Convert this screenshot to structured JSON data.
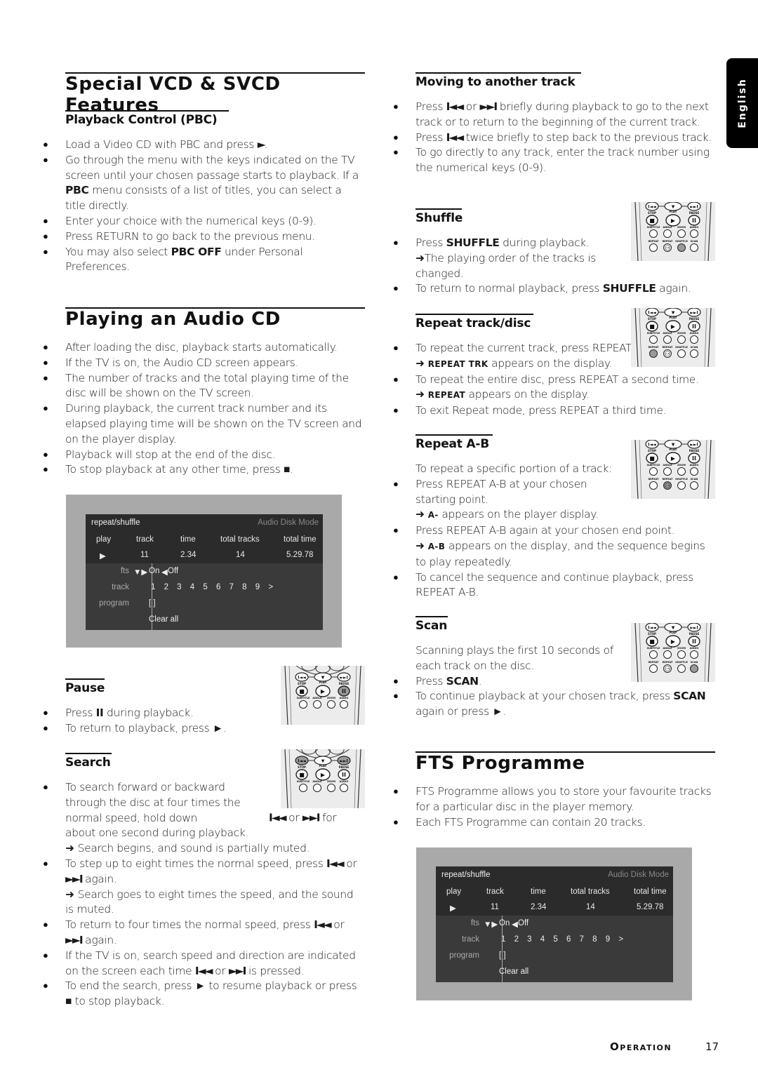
{
  "language_tab": "English",
  "footer": {
    "section": "Operation",
    "page_number": "17"
  },
  "vcd": {
    "title": "Special VCD & SVCD Features",
    "pbc": {
      "heading": "Playback Control (PBC)",
      "items": [
        {
          "pre": "Load a Video CD with PBC and press ",
          "glyph": "►",
          "post": "."
        },
        {
          "pre": "Go through the menu with the keys indicated on the TV screen until your chosen passage starts to playback. If a ",
          "bold": "PBC",
          "post": " menu consists of a list of titles, you can select a title directly."
        },
        {
          "text": "Enter your choice with the numerical keys (0-9)."
        },
        {
          "text": "Press RETURN to go back to the previous menu."
        },
        {
          "pre": "You may also select ",
          "bold": "PBC OFF",
          "post": " under Personal Preferences."
        }
      ]
    }
  },
  "audio": {
    "title": "Playing an Audio CD",
    "items": [
      "After loading the disc, playback starts automatically.",
      "If the TV is on, the Audio CD screen appears.",
      "The number of tracks and the total playing time of the disc will be shown on the TV screen.",
      "During playback, the current track number and its elapsed playing time will be shown on the TV screen and on the player display.",
      "Playback will stop at the end of the disc."
    ],
    "stop_item": {
      "pre": "To stop playback at any other time, press ",
      "glyph": "■",
      "post": "."
    }
  },
  "osd": {
    "title": "repeat/shuffle",
    "mode": "Audio Disk Mode",
    "headers": [
      "play",
      "track",
      "time",
      "total tracks",
      "total time"
    ],
    "values": {
      "play": "▶",
      "track": "11",
      "time": "2.34",
      "total_tracks": "14",
      "total_time": "5.29.78"
    },
    "fts_label": "fts",
    "fts_on": "On",
    "fts_off": "Off",
    "track_label": "track",
    "track_numbers": [
      "1",
      "2",
      "3",
      "4",
      "5",
      "6",
      "7",
      "8",
      "9",
      ">"
    ],
    "program_label": "program",
    "program_value": "[ ]",
    "clear_all": "Clear all"
  },
  "pause": {
    "heading": "Pause",
    "item1": {
      "pre": "Press ",
      "glyph": "II",
      "post": " during playback."
    },
    "item2": {
      "pre": "To return to playback, press ",
      "glyph": "►",
      "post": "."
    }
  },
  "search": {
    "heading": "Search",
    "item1": {
      "text": "To search forward or backward through the disc at four times the normal speed, hold down ",
      "g1": "I◄◄",
      "mid": " or ",
      "g2": "►►I",
      "post": " for about one second during playback."
    },
    "arrow1": "Search begins, and sound is partially muted.",
    "item2": {
      "pre": "To step up to eight times the normal speed, press ",
      "g1": "I◄◄",
      "mid": " or ",
      "g2": "►►I",
      "post": " again."
    },
    "arrow2": "Search goes to eight times the speed, and the sound is muted.",
    "item3": {
      "pre": "To return to four times the normal speed, press ",
      "g1": "I◄◄",
      "mid": " or ",
      "g2": "►►I",
      "post": " again."
    },
    "item4": {
      "pre": "If the TV is on, search speed and direction are indicated on the screen each time ",
      "g1": "I◄◄",
      "mid": " or ",
      "g2": "►►I",
      "post": " is pressed."
    },
    "item5": {
      "pre": "To end the search, press ",
      "g1": "►",
      "mid": " to resume playback or press ",
      "g2": "■",
      "post": " to stop playback."
    }
  },
  "moving": {
    "heading": "Moving to another track",
    "item1": {
      "pre": "Press ",
      "g1": "I◄◄",
      "mid": " or ",
      "g2": "►►I",
      "post": " briefly during playback to go to the next track or to return to the beginning of the current track."
    },
    "item2": {
      "pre": "Press ",
      "g1": "I◄◄",
      "post": " twice briefly to step back to the previous track."
    },
    "item3": "To go directly to any track, enter the track number using the numerical keys (0-9)."
  },
  "shuffle": {
    "heading": "Shuffle",
    "item1": {
      "pre": "Press ",
      "bold": "SHUFFLE",
      "post": " during playback."
    },
    "arrow": "The playing order of the tracks is changed.",
    "item2": {
      "pre": "To return to normal playback, press ",
      "bold": "SHUFFLE",
      "post": " again."
    }
  },
  "repeat": {
    "heading": "Repeat track/disc",
    "item1": "To repeat the current track, press REPEAT.",
    "arrow1": {
      "sc": "REPEAT TRK",
      "post": " appears on the display."
    },
    "item2": "To repeat the entire disc, press REPEAT a second time.",
    "arrow2": {
      "sc": "REPEAT",
      "post": " appears on the display."
    },
    "item3": "To exit Repeat mode, press REPEAT a third time."
  },
  "repeat_ab": {
    "heading": "Repeat A-B",
    "intro": "To repeat a specific portion of a track:",
    "item1": "Press REPEAT A-B at your chosen starting point.",
    "arrow1": {
      "sc": "A-",
      "post": " appears on the player display."
    },
    "item2": "Press REPEAT A-B again at your chosen end point.",
    "arrow2": {
      "sc": "A-B",
      "post": " appears on the display, and the sequence begins to play repeatedly."
    },
    "item3": "To cancel the sequence and continue playback, press REPEAT A-B."
  },
  "scan": {
    "heading": "Scan",
    "intro": "Scanning plays the first 10 seconds of each track on the disc.",
    "item1": {
      "pre": "Press ",
      "bold": "SCAN",
      "post": "."
    },
    "item2": {
      "pre": "To continue playback at your chosen track, press ",
      "bold": "SCAN",
      "post": " again or press ",
      "glyph": "►",
      "post2": "."
    }
  },
  "fts": {
    "title": "FTS Programme",
    "items": [
      "FTS Programme allows you to store your favourite tracks for a particular disc in the player memory.",
      "Each FTS Programme can contain 20 tracks."
    ]
  },
  "remote": {
    "row1": [
      "I◄◄",
      "▼",
      "►►I"
    ],
    "row2_labels": [
      "STOP",
      "PLAY",
      "PAUSE"
    ],
    "row3_labels": [
      "SUBTITLE",
      "ANGLE",
      "ZOOM",
      "AUDIO"
    ],
    "row4_labels": [
      "REPEAT",
      "REPEAT",
      "SHUFFLE",
      "SCAN"
    ],
    "ab_label": "A-B",
    "highlight_color": "#9a9a9a"
  }
}
